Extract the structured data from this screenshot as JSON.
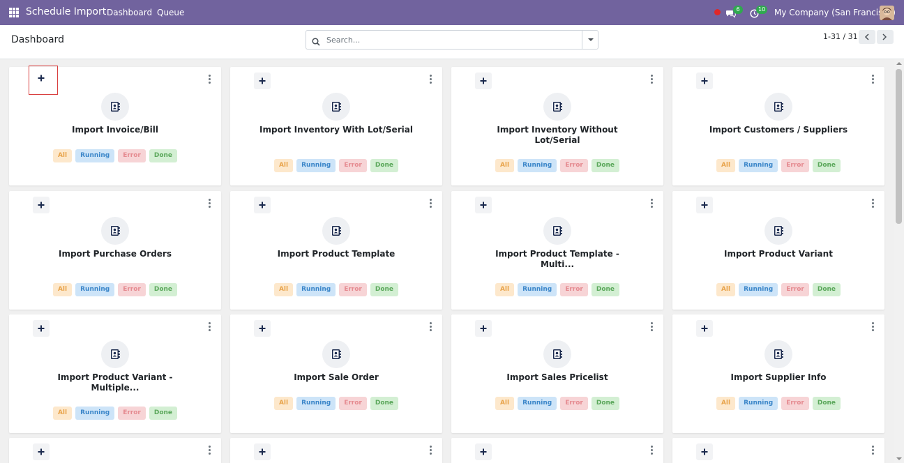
{
  "navbar": {
    "app_name": "Schedule Import",
    "menu": [
      "Dashboard",
      "Queue"
    ],
    "messages_count": "6",
    "activities_count": "10",
    "company": "My Company (San Francisco)",
    "icons": [
      "apps-grid-icon",
      "recording-dot-icon",
      "chat-icon",
      "clock-icon",
      "avatar"
    ]
  },
  "control_panel": {
    "title": "Dashboard",
    "search_placeholder": "Search...",
    "pager": "1-31 / 31"
  },
  "status_tags": {
    "all": "All",
    "running": "Running",
    "error": "Error",
    "done": "Done"
  },
  "cards": [
    {
      "title": "Import Invoice/Bill"
    },
    {
      "title": "Import Inventory With Lot/Serial"
    },
    {
      "title": "Import Inventory Without Lot/Serial"
    },
    {
      "title": "Import Customers / Suppliers"
    },
    {
      "title": "Import Purchase Orders"
    },
    {
      "title": "Import Product Template"
    },
    {
      "title": "Import Product Template - Multi..."
    },
    {
      "title": "Import Product Variant"
    },
    {
      "title": "Import Product Variant - Multiple..."
    },
    {
      "title": "Import Sale Order"
    },
    {
      "title": "Import Sales Pricelist"
    },
    {
      "title": "Import Supplier Info"
    }
  ],
  "colors": {
    "navbar": "#71639e",
    "tag_all": "#fde8cc",
    "tag_running": "#cde4f8",
    "tag_error": "#f7d4d6",
    "tag_done": "#d3efd3",
    "highlight": "#d94040"
  }
}
